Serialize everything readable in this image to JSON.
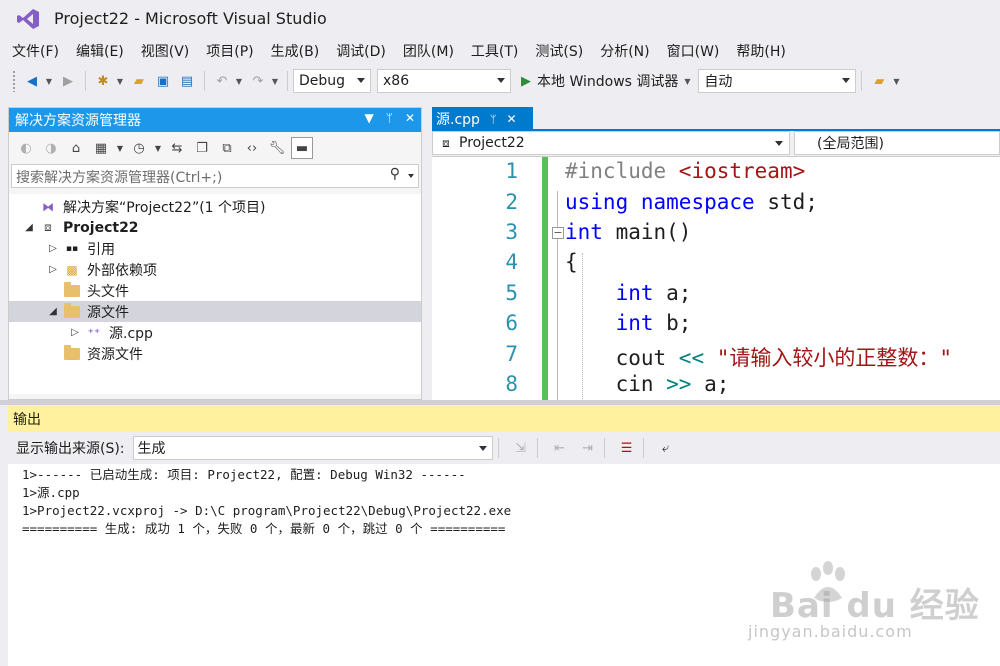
{
  "window": {
    "title": "Project22 - Microsoft Visual Studio"
  },
  "menu": [
    "文件(F)",
    "编辑(E)",
    "视图(V)",
    "项目(P)",
    "生成(B)",
    "调试(D)",
    "团队(M)",
    "工具(T)",
    "测试(S)",
    "分析(N)",
    "窗口(W)",
    "帮助(H)"
  ],
  "toolbar": {
    "config": "Debug",
    "platform": "x86",
    "run_label": "本地 Windows 调试器",
    "run_mode": "自动"
  },
  "solution_explorer": {
    "title": "解决方案资源管理器",
    "search_placeholder": "搜索解决方案资源管理器(Ctrl+;)",
    "tree": [
      {
        "label": "解决方案“Project22”(1 个项目)",
        "level": 0,
        "icon": "solution-icon",
        "toggle": ""
      },
      {
        "label": "Project22",
        "level": 0,
        "icon": "project-icon",
        "toggle": "expanded",
        "bold": true
      },
      {
        "label": "引用",
        "level": 1,
        "icon": "references-icon",
        "toggle": "collapsed"
      },
      {
        "label": "外部依赖项",
        "level": 1,
        "icon": "external-deps-icon",
        "toggle": "collapsed"
      },
      {
        "label": "头文件",
        "level": 1,
        "icon": "folder-icon",
        "toggle": ""
      },
      {
        "label": "源文件",
        "level": 1,
        "icon": "folder-icon",
        "toggle": "expanded",
        "selected": true
      },
      {
        "label": "源.cpp",
        "level": 2,
        "icon": "cpp-file-icon",
        "toggle": "collapsed"
      },
      {
        "label": "资源文件",
        "level": 1,
        "icon": "folder-icon",
        "toggle": ""
      }
    ]
  },
  "editor": {
    "tab_label": "源.cpp",
    "nav_project": "Project22",
    "nav_scope": "(全局范围)",
    "lines": [
      {
        "num": "1",
        "tokens": [
          [
            "pp",
            "#include "
          ],
          [
            "str",
            "<iostream>"
          ]
        ]
      },
      {
        "num": "2",
        "tokens": [
          [
            "kw",
            "using"
          ],
          [
            "",
            " "
          ],
          [
            "kw",
            "namespace"
          ],
          [
            "",
            " std;"
          ]
        ]
      },
      {
        "num": "3",
        "tokens": [
          [
            "kw",
            "int"
          ],
          [
            "",
            " main()"
          ]
        ]
      },
      {
        "num": "4",
        "tokens": [
          [
            "",
            "{"
          ]
        ]
      },
      {
        "num": "5",
        "tokens": [
          [
            "",
            "    "
          ],
          [
            "kw",
            "int"
          ],
          [
            "",
            " a;"
          ]
        ]
      },
      {
        "num": "6",
        "tokens": [
          [
            "",
            "    "
          ],
          [
            "kw",
            "int"
          ],
          [
            "",
            " b;"
          ]
        ]
      },
      {
        "num": "7",
        "tokens": [
          [
            "",
            "    cout "
          ],
          [
            "op",
            "<<"
          ],
          [
            "",
            " "
          ],
          [
            "str",
            "\"请输入较小的正整数：\""
          ]
        ]
      },
      {
        "num": "8",
        "tokens": [
          [
            "",
            "    cin "
          ],
          [
            "op",
            ">>"
          ],
          [
            "",
            " a;"
          ]
        ]
      }
    ]
  },
  "output": {
    "title": "输出",
    "source_label": "显示输出来源(S):",
    "source_value": "生成",
    "lines": [
      "1>------ 已启动生成: 项目: Project22, 配置: Debug Win32 ------",
      "1>源.cpp",
      "1>Project22.vcxproj -> D:\\C program\\Project22\\Debug\\Project22.exe",
      "========== 生成: 成功 1 个，失败 0 个，最新 0 个，跳过 0 个 =========="
    ]
  },
  "watermark": {
    "brand": "Bai du 经验",
    "url": "jingyan.baidu.com"
  },
  "colors": {
    "accent": "#007acc",
    "panel_header": "#1c97ea",
    "output_header": "#fff19d",
    "change_bar": "#57c157"
  }
}
